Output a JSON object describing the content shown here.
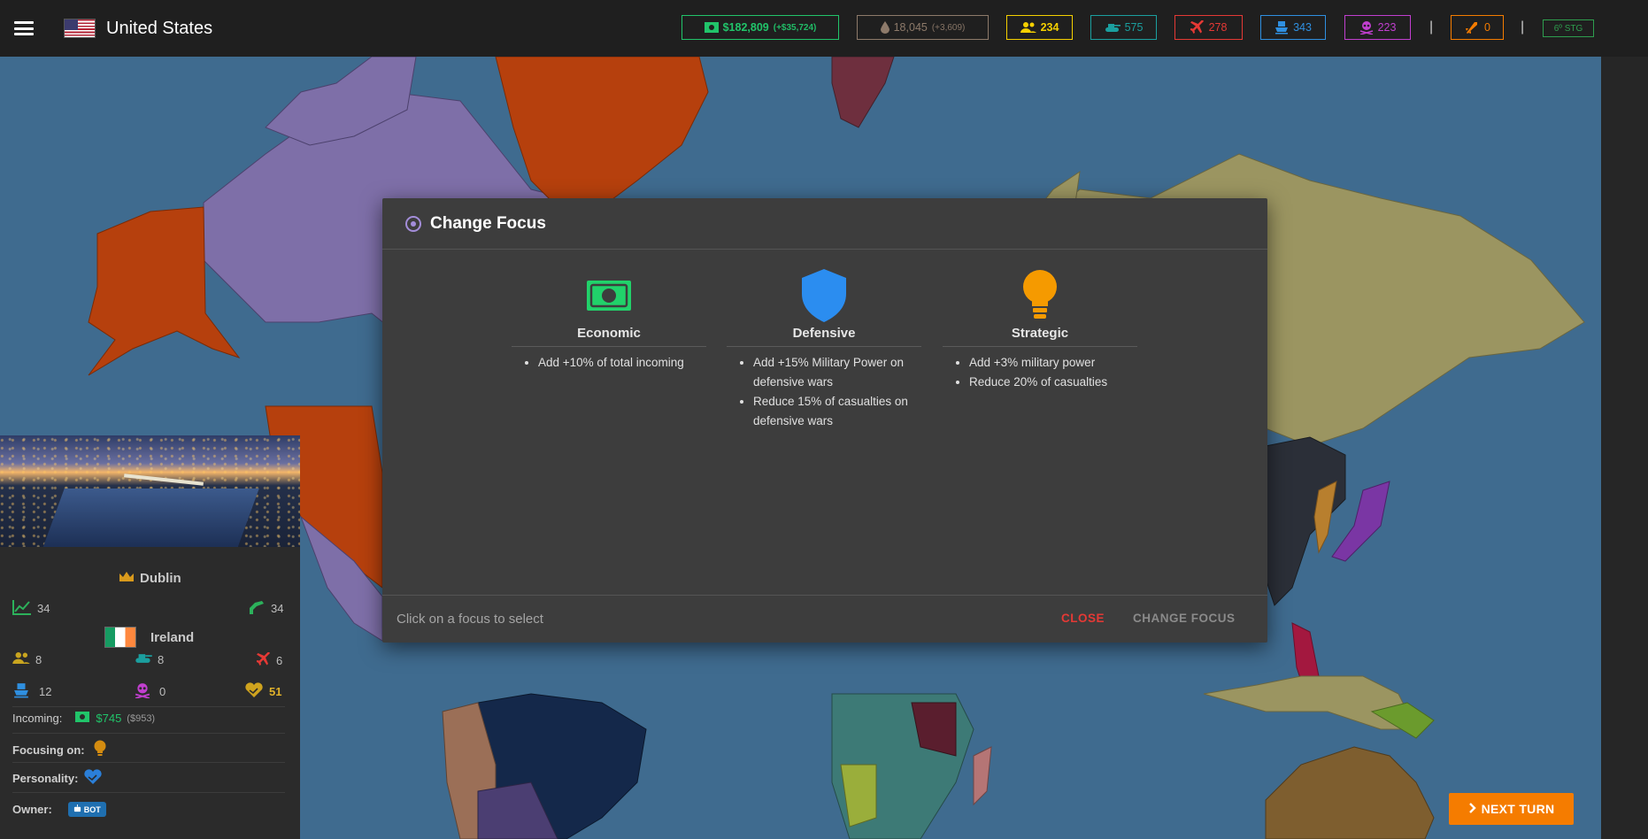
{
  "header": {
    "country_name": "United States",
    "menu_icon": "hamburger-menu-icon",
    "flag_icon": "us-flag-icon"
  },
  "stats": {
    "money": {
      "value": "$182,809",
      "delta": "(+$35,724)",
      "color": "#21c46a",
      "icon": "cash-icon"
    },
    "oil": {
      "value": "18,045",
      "delta": "(+3,609)",
      "color": "#8d7a6a",
      "icon": "oil-drop-icon"
    },
    "population": {
      "value": "234",
      "color": "#f5d000",
      "icon": "people-icon"
    },
    "tanks": {
      "value": "575",
      "color": "#1b9f9f",
      "icon": "tank-icon"
    },
    "aircraft": {
      "value": "278",
      "color": "#e53935",
      "icon": "airplane-icon"
    },
    "ships": {
      "value": "343",
      "color": "#2f8fe0",
      "icon": "ship-icon"
    },
    "nukes": {
      "value": "223",
      "color": "#c13fcf",
      "icon": "skull-icon"
    },
    "missiles": {
      "value": "0",
      "color": "#f57c00",
      "icon": "missile-icon"
    },
    "stage": {
      "value": "6º STG",
      "color": "#2e9e4e"
    }
  },
  "modal": {
    "title": "Change Focus",
    "focuses": [
      {
        "name": "Economic",
        "icon": "cash-icon",
        "color": "#21d26a",
        "bullets": [
          "Add +10% of total incoming"
        ]
      },
      {
        "name": "Defensive",
        "icon": "shield-icon",
        "color": "#2b8df0",
        "bullets": [
          "Add +15% Military Power on defensive wars",
          "Reduce 15% of casualties on defensive wars"
        ]
      },
      {
        "name": "Strategic",
        "icon": "lightbulb-icon",
        "color": "#f59a00",
        "bullets": [
          "Add +3% military power",
          "Reduce 20% of casualties"
        ]
      }
    ],
    "hint": "Click on a focus to select",
    "close_label": "CLOSE",
    "change_label": "CHANGE FOCUS"
  },
  "side_panel": {
    "capital": "Dublin",
    "country": "Ireland",
    "economy": "34",
    "industry": "34",
    "population": "8",
    "tanks": "8",
    "aircraft": "6",
    "ships": "12",
    "nukes": "0",
    "relations": "51",
    "incoming_label": "Incoming:",
    "incoming_value": "$745",
    "incoming_sub": "($953)",
    "focusing_label": "Focusing on:",
    "personality_label": "Personality:",
    "owner_label": "Owner:",
    "owner_badge": "BOT"
  },
  "next_turn_label": "NEXT TURN"
}
